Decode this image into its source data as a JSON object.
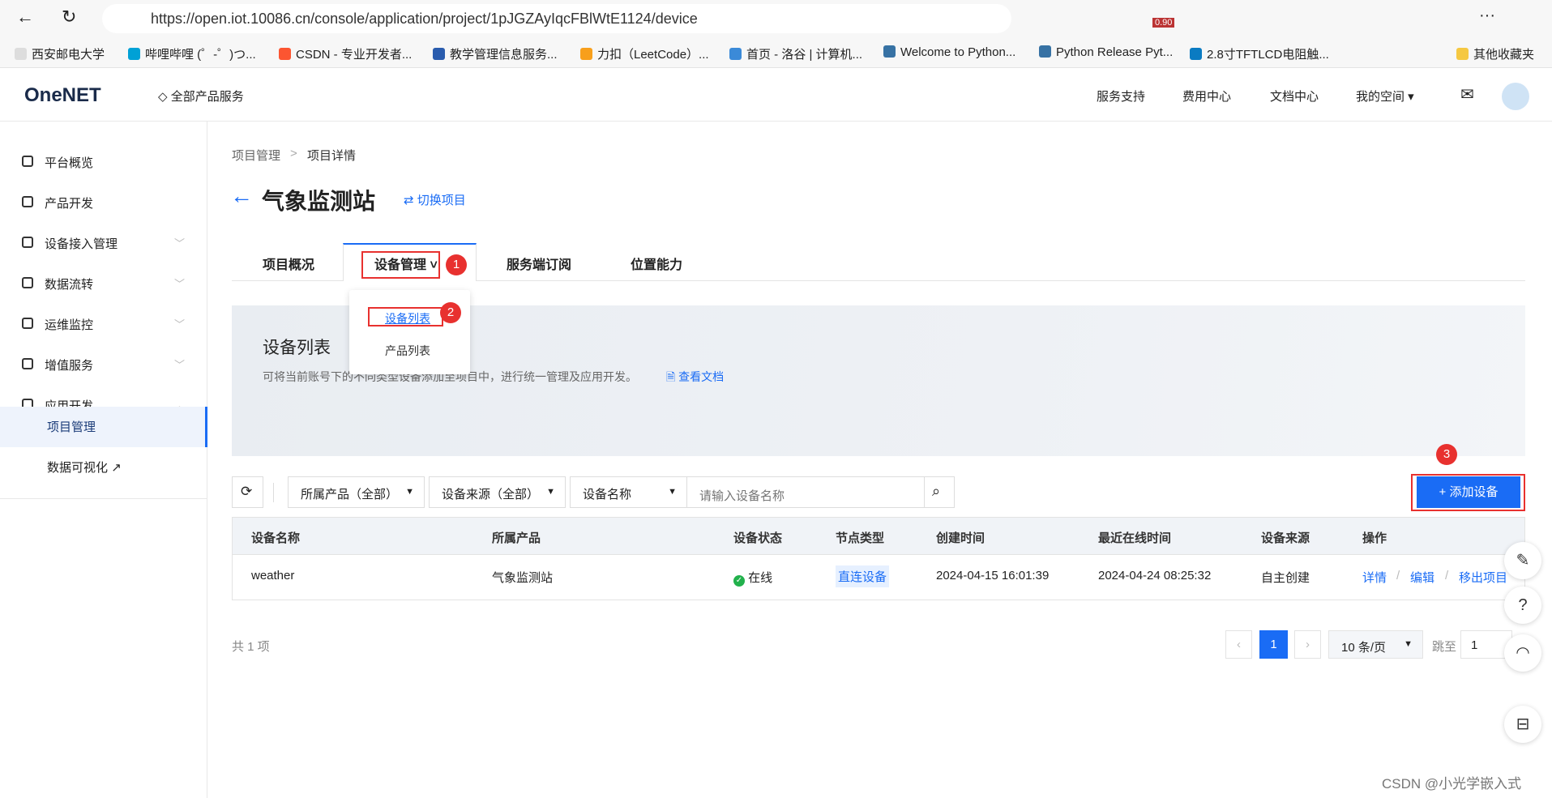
{
  "browser": {
    "url": "https://open.iot.10086.cn/console/application/project/1pJGZAyIqcFBlWtE1124/device",
    "ext_badge": "0.90",
    "bookmarks": [
      "西安邮电大学",
      "哔哩哔哩 (゜-゜)つ...",
      "CSDN - 专业开发者...",
      "教学管理信息服务...",
      "力扣（LeetCode）...",
      "首页 - 洛谷 | 计算机...",
      "Welcome to Python...",
      "Python Release Pyt...",
      "2.8寸TFTLCD电阻触...",
      "其他收藏夹"
    ]
  },
  "header": {
    "logo": "OneNET",
    "all_products": "全部产品服务",
    "nav": [
      "服务支持",
      "费用中心",
      "文档中心",
      "我的空间"
    ]
  },
  "sidebar": {
    "items": [
      {
        "label": "平台概览"
      },
      {
        "label": "产品开发"
      },
      {
        "label": "设备接入管理",
        "chevron": "down"
      },
      {
        "label": "数据流转",
        "chevron": "down"
      },
      {
        "label": "运维监控",
        "chevron": "down"
      },
      {
        "label": "增值服务",
        "chevron": "down"
      },
      {
        "label": "应用开发",
        "chevron": "up"
      },
      {
        "label": "项目管理",
        "active": true
      },
      {
        "label": "数据可视化"
      }
    ]
  },
  "breadcrumb": [
    "项目管理",
    ">",
    "项目详情"
  ],
  "title": "气象监测站",
  "switch_project": "切换项目",
  "tabs": [
    "项目概况",
    "设备管理",
    "服务端订阅",
    "位置能力"
  ],
  "dropdown": [
    "设备列表",
    "产品列表"
  ],
  "banner": {
    "title": "设备列表",
    "desc": "可将当前账号下的不同类型设备添加至项目中，进行统一管理及应用开发。",
    "doc_link": "查看文档"
  },
  "filters": {
    "product": "所属产品（全部）",
    "source": "设备来源（全部）",
    "field": "设备名称",
    "placeholder": "请输入设备名称"
  },
  "add_button": "+ 添加设备",
  "table": {
    "headers": [
      "设备名称",
      "所属产品",
      "设备状态",
      "节点类型",
      "创建时间",
      "最近在线时间",
      "设备来源",
      "操作"
    ],
    "rows": [
      {
        "name": "weather",
        "product": "气象监测站",
        "status": "在线",
        "node": "直连设备",
        "created": "2024-04-15 16:01:39",
        "last_online": "2024-04-24 08:25:32",
        "source": "自主创建",
        "actions": [
          "详情",
          "编辑",
          "移出项目"
        ]
      }
    ]
  },
  "pagination": {
    "total": "共 1 项",
    "page": "1",
    "page_size": "10 条/页",
    "jump_label": "跳至",
    "jump_value": "1"
  },
  "annotations": [
    "1",
    "2",
    "3"
  ],
  "watermark": "CSDN @小光学嵌入式",
  "colors": {
    "primary": "#1a6cf5",
    "annotation": "#e8312f",
    "online": "#22b14c"
  }
}
